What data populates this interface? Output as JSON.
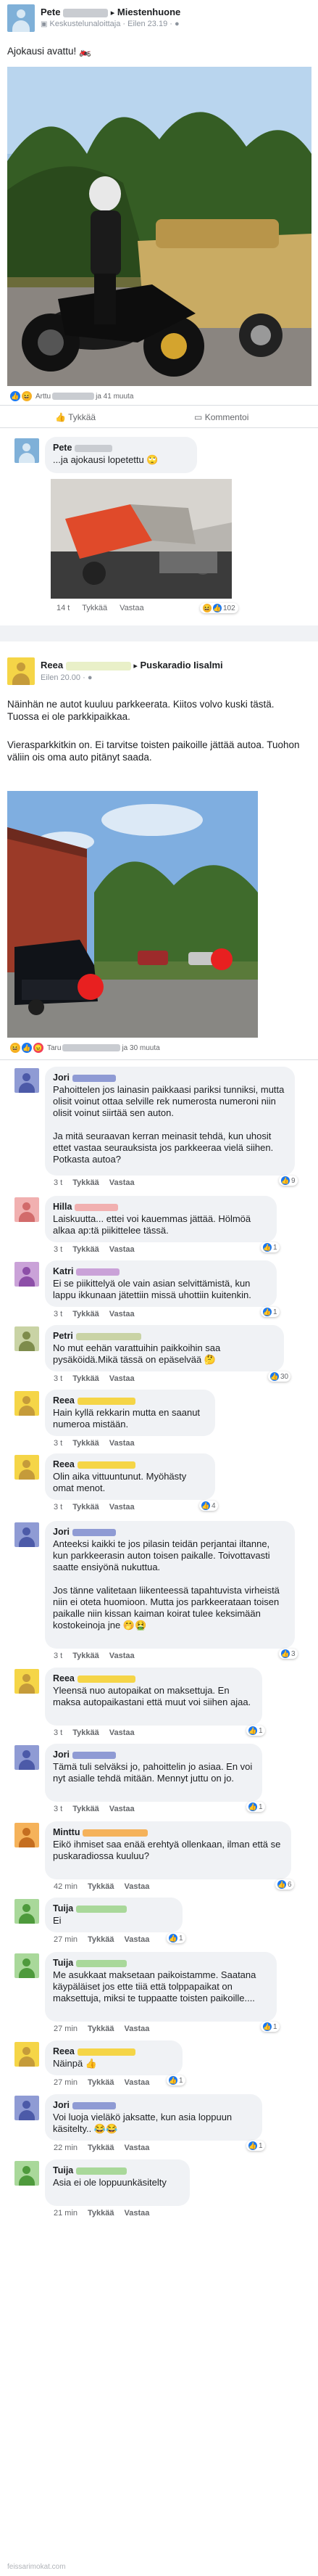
{
  "post1": {
    "author": "Pete",
    "group": "Miestenhuone",
    "author_badge": "Keskustelunaloittaja",
    "time": "Eilen 23.19",
    "text": "Ajokausi avattu! 🏍️",
    "reactions_summary": "Arttu",
    "reactions_more": "ja 41 muuta",
    "like_label": "Tykkää",
    "comment_label": "Kommentoi"
  },
  "reply1": {
    "author": "Pete",
    "text": "...ja ajokausi lopetettu 🙄",
    "time": "14 t",
    "like": "Tykkää",
    "reply": "Vastaa",
    "count": "102"
  },
  "post2": {
    "author": "Reea",
    "group": "Puskaradio Iisalmi",
    "time": "Eilen 20.00",
    "text1": "Näinhän ne autot kuuluu parkkeerata. Kiitos volvo kuski tästä. Tuossa ei ole parkkipaikkaa.",
    "text2": "Vierasparkkitkin on. Ei tarvitse toisten paikoille jättää autoa. Tuohon väliin ois oma auto pitänyt saada.",
    "reactions_summary": "Taru",
    "reactions_more": "ja 30 muuta"
  },
  "comments": [
    {
      "name": "Jori",
      "text": "Pahoittelen jos lainasin paikkaasi pariksi tunniksi, mutta olisit voinut ottaa selville rek numerosta numeroni niin olisit voinut siirtää sen auton.\n\nJa mitä seuraavan kerran meinasit tehdä, kun uhosit ettet vastaa seurauksista jos parkkeeraa vielä siihen. Potkasta autoa?",
      "time": "3 t",
      "count": "9"
    },
    {
      "name": "Hilla",
      "text": "Laiskuutta... ettei voi kauemmas jättää. Hölmöä alkaa ap:tä piikittelee tässä.",
      "time": "3 t",
      "count": "1"
    },
    {
      "name": "Katri",
      "text": "Ei se piikittelyä ole vain asian selvittämistä, kun lappu ikkunaan jätettiin missä uhottiin kuitenkin.",
      "time": "3 t",
      "count": "1"
    },
    {
      "name": "Petri",
      "text": "No mut eehän varattuihin paikkoihin saa pysäköidä.Mikä tässä on epäselvää 🤔",
      "time": "3 t",
      "count": "30"
    },
    {
      "name": "Reea",
      "text": "Hain kyllä rekkarin mutta en saanut numeroa mistään.",
      "time": "3 t",
      "count": ""
    },
    {
      "name": "Reea",
      "text": "Olin aika vittuuntunut. Myöhästy omat menot.",
      "time": "3 t",
      "count": "4"
    },
    {
      "name": "Jori",
      "text": "Anteeksi kaikki te jos pilasin teidän perjantai iltanne, kun parkkeerasin auton toisen paikalle. Toivottavasti saatte ensiyönä nukuttua.\n\nJos tänne valitetaan liikenteessä tapahtuvista virheistä niin ei oteta huomioon. Mutta jos parkkeerataan toisen paikalle niin kissan kaiman koirat tulee keksimään kostokeinoja jne 🤭🤮",
      "time": "3 t",
      "count": "3"
    },
    {
      "name": "Reea",
      "text": "Yleensä nuo autopaikat on maksettuja. En maksa autopaikastani että muut voi siihen ajaa.",
      "time": "3 t",
      "count": "1"
    },
    {
      "name": "Jori",
      "text": "Tämä tuli selväksi jo, pahoittelin jo asiaa. En voi nyt asialle tehdä mitään. Mennyt juttu on jo.",
      "time": "3 t",
      "count": "1"
    },
    {
      "name": "Minttu",
      "text": "Eikö ihmiset saa enää erehtyä ollenkaan, ilman että se puskaradiossa kuuluu?",
      "time": "42 min",
      "count": "6"
    },
    {
      "name": "Tuija",
      "text": "Ei",
      "time": "27 min",
      "count": "1"
    },
    {
      "name": "Tuija",
      "text": "Me asukkaat maksetaan paikoistamme. Saatana käypäläiset jos ette tiiä että tolppapaikat on maksettuja, miksi te tuppaatte toisten paikoille....",
      "time": "27 min",
      "count": "1"
    },
    {
      "name": "Reea",
      "text": "Näinpä 👍",
      "time": "27 min",
      "count": "1"
    },
    {
      "name": "Jori",
      "text": "Voi luoja vieläkö jaksatte, kun asia loppuun käsitelty.. 😂😂",
      "time": "22 min",
      "count": "1"
    },
    {
      "name": "Tuija",
      "text": "Asia ei ole loppuunkäsitelty",
      "time": "21 min",
      "count": ""
    }
  ],
  "ui": {
    "like": "Tykkää",
    "reply": "Vastaa"
  },
  "watermark": "feissarimokat.com"
}
